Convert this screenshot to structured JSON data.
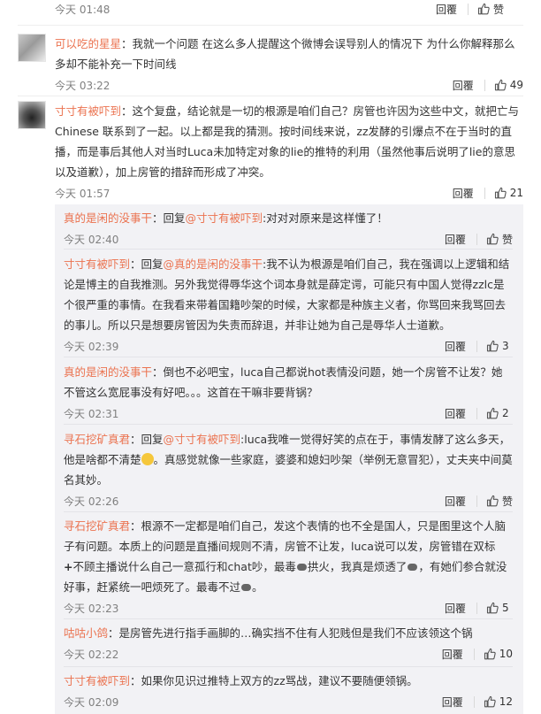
{
  "actions": {
    "reply_label": "回覆"
  },
  "top_prev": {
    "time": "今天 01:48",
    "likes": ""
  },
  "comments": [
    {
      "name": "可以吃的星星",
      "text": "：我就一个问题 在这么多人提醒这个微博会误导别人的情况下 为什么你解释那么多却不能补充一下时间线",
      "time": "今天 03:22",
      "likes": "49"
    },
    {
      "name": "寸寸有被吓到",
      "text": "：这个复盘，结论就是一切的根源是咱们自己？房管也许因为这些中文，就把亡与Chinese 联系到了一起。以上都是我的猜测。按时间线来说，zz发酵的引爆点不在于当时的直播，而是事后其他人对当时Luca未加特定对象的lie的推特的利用（虽然他事后说明了lie的意思以及道歉），加上房管的措辞而形成了冲突。",
      "time": "今天 01:57",
      "likes": "21"
    }
  ],
  "replies": [
    {
      "name": "真的是闲的没事干",
      "prefix": "：回复",
      "mention": "@寸寸有被吓到",
      "text": ":对对对原来是这样懂了！",
      "time": "今天 02:40",
      "likes": ""
    },
    {
      "name": "寸寸有被吓到",
      "prefix": "：回复",
      "mention": "@真的是闲的没事干",
      "text": ":我不认为根源是咱们自己，我在强调以上逻辑和结论是博主的自我推测。另外我觉得辱华这个词本身就是薛定谔，可能只有中国人觉得zzlc是个很严重的事情。在我看来带着国籍吵架的时候，大家都是种族主义者，你骂回来我骂回去的事儿。所以只是想要房管因为失责而辞退，并非让她为自己是辱华人士道歉。",
      "time": "今天 02:39",
      "likes": "3"
    },
    {
      "name": "真的是闲的没事干",
      "prefix": "",
      "mention": "",
      "text": "：倒也不必吧宝，luca自己都说hot表情没问题，她一个房管不让发？她不管这么宽屁事没有好吧。。。这首在干嘛非要背锅？",
      "time": "今天 02:31",
      "likes": "2"
    },
    {
      "name": "寻石挖矿真君",
      "prefix": "：回复",
      "mention": "@寸寸有被吓到",
      "text_a": ":luca我唯一觉得好笑的点在于，事情发酵了这么多天，他是啥都不清楚",
      "text_b": "。真感觉就像一些家庭，婆婆和媳妇吵架（举例无意冒犯），丈夫夹中间莫名其妙。",
      "time": "今天 02:26",
      "likes": ""
    },
    {
      "name": "寻石挖矿真君",
      "prefix": "",
      "mention": "",
      "text_a": "：根源不一定都是咱们自己，发这个表情的也不全是国人，只是图里这个人脑子有问题。本质上的问题是直播间规则不清，房管不让发，luca说可以发，房管错在双标",
      "text_cross": "+",
      "text_b": "不顾主播说什么自己一意孤行和chat吵，最毒",
      "text_c": "拱火，我真是烦透了",
      "text_d": "，有她们参合就没好事，赶紧统一吧烦死了。最毒不过",
      "text_e": "。",
      "time": "今天 02:23",
      "likes": "5"
    },
    {
      "name": "咕咕小鸽",
      "prefix": "",
      "mention": "",
      "text": "：是房管先进行指手画脚的…确实挡不住有人犯贱但是我们不应该领这个锅",
      "time": "今天 02:22",
      "likes": "10"
    },
    {
      "name": "寸寸有被吓到",
      "prefix": "",
      "mention": "",
      "text": "：如果你见识过推特上双方的zz骂战，建议不要随便领锅。",
      "time": "今天 02:09",
      "likes": "12"
    }
  ],
  "colors": {
    "accent": "#eb7350",
    "reply_bg": "#f2f2f5",
    "time": "#808080"
  }
}
